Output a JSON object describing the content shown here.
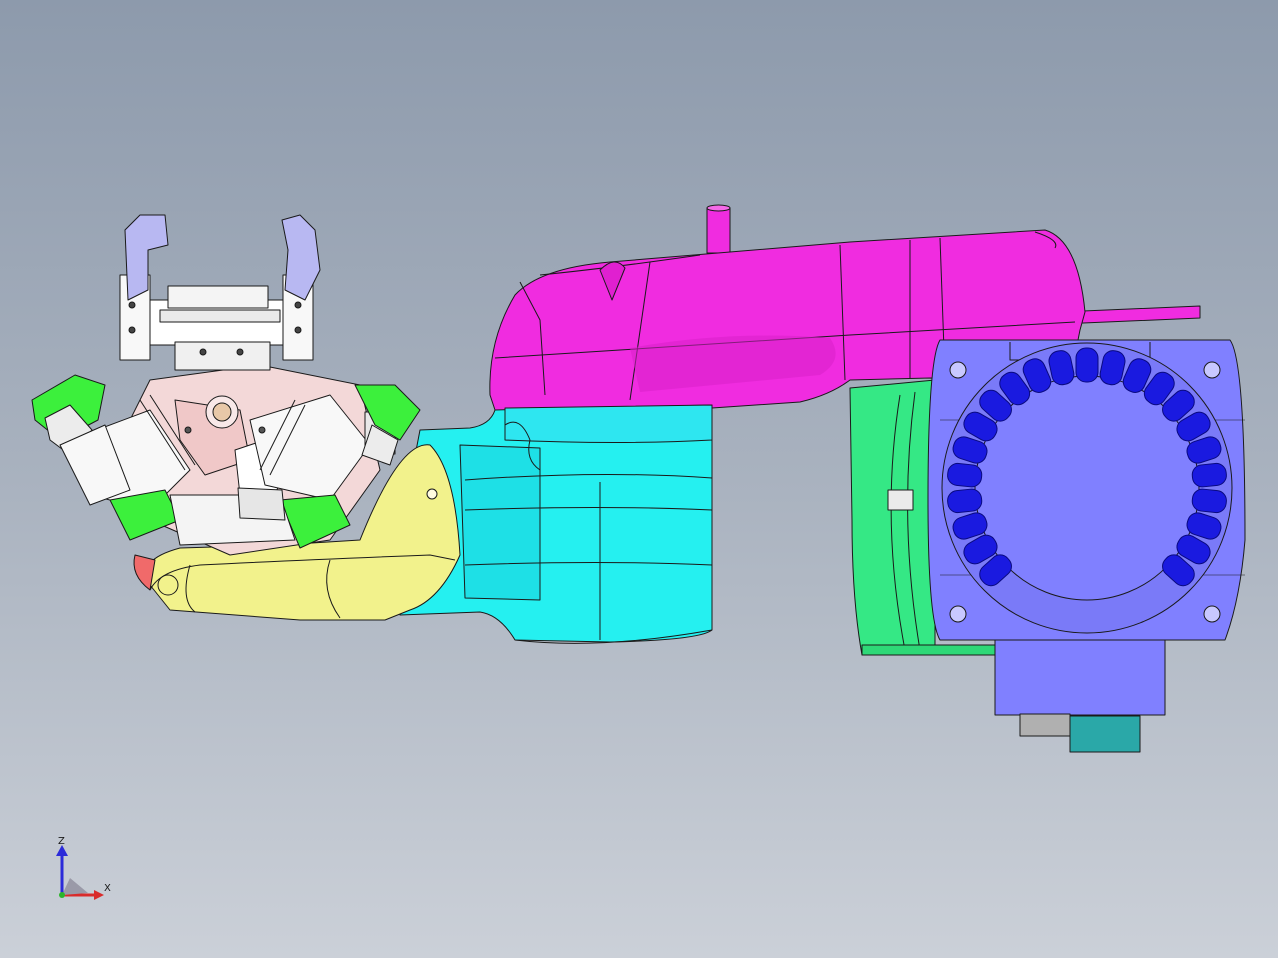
{
  "viewport": {
    "background_top": "#8d9aac",
    "background_bottom": "#cbd0d8"
  },
  "triad": {
    "z_label": "Z",
    "x_label": "X",
    "z_color": "#2b2bd9",
    "x_color": "#d92b2b",
    "y_color": "#2bb52b"
  },
  "parts": {
    "upper_arm_color": "#f02ce0",
    "forearm_color": "#25f0f0",
    "wrist_color": "#f2f28c",
    "base_motor_color": "#8080ff",
    "column_color": "#35e885",
    "gripper_pad_color": "#3cf03c",
    "finger_tip_color": "#b8b8f2",
    "cable_color": "#2aa8a8"
  }
}
